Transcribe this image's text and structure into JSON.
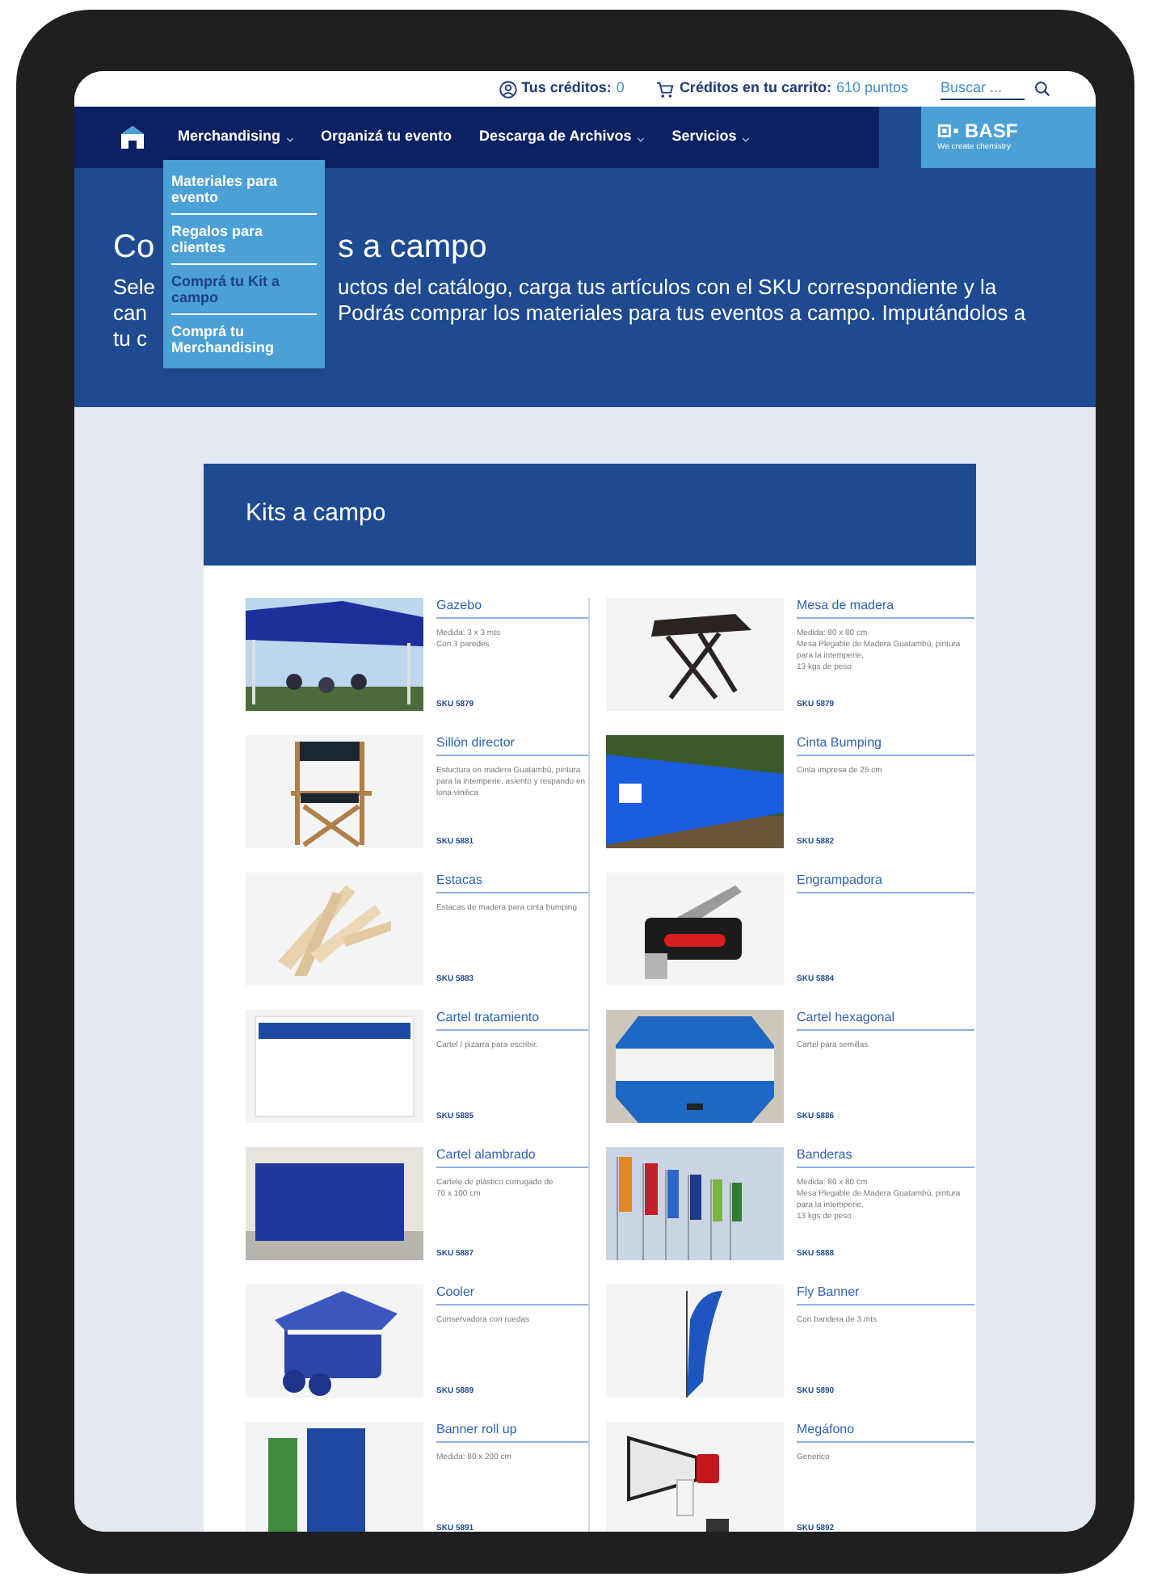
{
  "top_bar": {
    "credits_label": "Tus créditos:",
    "credits_value": "0",
    "cart_label": "Créditos en tu carrito:",
    "cart_value": "610 puntos",
    "search": {
      "placeholder": "Buscar ..."
    }
  },
  "nav": {
    "items": [
      {
        "label": "Merchandising",
        "has_menu": true
      },
      {
        "label": "Organizá tu evento",
        "has_menu": false
      },
      {
        "label": "Descarga de Archivos",
        "has_menu": true
      },
      {
        "label": "Servicios",
        "has_menu": true
      }
    ],
    "logo": {
      "name": "BASF",
      "tagline": "We create chemistry"
    }
  },
  "dropdown": {
    "items": [
      {
        "label": "Materiales para evento",
        "selected": false
      },
      {
        "label": "Regalos para clientes",
        "selected": false
      },
      {
        "label": "Comprá tu Kit a campo",
        "selected": true
      },
      {
        "label": "Comprá tu Merchandising",
        "selected": false
      }
    ]
  },
  "hero": {
    "title_parts": [
      "Co",
      "s a campo"
    ],
    "description_lines": [
      [
        "Sele",
        "uctos del catálogo, carga tus artículos con el SKU correspondiente y la"
      ],
      [
        "can",
        "Podrás comprar los materiales para tus eventos a campo. Imputándolos a"
      ],
      [
        "tu c"
      ]
    ]
  },
  "catalog": {
    "title": "Kits a campo",
    "products": [
      {
        "title": "Gazebo",
        "description": "Medida: 3 x 3 mts\nCon 3 paredes",
        "sku": "SKU 5879"
      },
      {
        "title": "Mesa de madera",
        "description": "Medida: 80 x 80 cm\nMesa Plegable de Madera Guatambú, pintura para la intemperie,\n13 kgs de peso",
        "sku": "SKU 5879"
      },
      {
        "title": "Sillón director",
        "description": "Estuctura en madera Guatambú, pintura para la intemperie, asiento y respando en lona vinilica",
        "sku": "SKU 5881"
      },
      {
        "title": "Cinta Bumping",
        "description": "Cinta impresa de 25 cm",
        "sku": "SKU 5882"
      },
      {
        "title": "Estacas",
        "description": "Estacas de madera para cinta bumping",
        "sku": "SKU 5883"
      },
      {
        "title": "Engrampadora",
        "sku": "SKU 5884"
      },
      {
        "title": "Cartel tratamiento",
        "description": "Cartel / pizarra para escribir.",
        "sku": "SKU 5885"
      },
      {
        "title": "Cartel hexagonal",
        "description": "Cartel para semillas",
        "sku": "SKU 5886"
      },
      {
        "title": "Cartel alambrado",
        "description": "Cartele de plástico corrugado de\n70 x 100 cm",
        "sku": "SKU 5887"
      },
      {
        "title": "Banderas",
        "description": "Medida: 80 x 80 cm\nMesa Plegable de Madera Guatambú, pintura para la intemperie,\n13 kgs de peso",
        "sku": "SKU 5888"
      },
      {
        "title": "Cooler",
        "description": "Conservadora con ruedas",
        "sku": "SKU 5889"
      },
      {
        "title": "Fly Banner",
        "description": "Con bandera de 3 mts",
        "sku": "SKU 5890"
      },
      {
        "title": "Banner roll up",
        "description": "Medida: 80 x 200 cm",
        "sku": "SKU 5891"
      },
      {
        "title": "Megáfono",
        "description": "Generico",
        "sku": "SKU 5892"
      }
    ]
  }
}
